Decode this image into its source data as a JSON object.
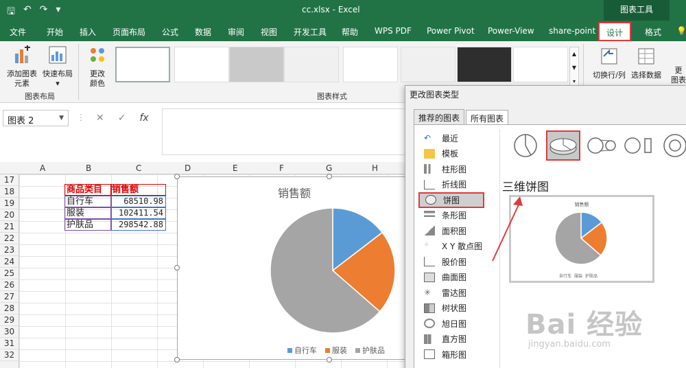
{
  "window": {
    "filename": "cc.xlsx",
    "app": "Excel",
    "separator": "-",
    "context_tools": "图表工具"
  },
  "qat": [
    "save-icon",
    "undo-icon",
    "redo-icon",
    "customize-icon"
  ],
  "tabs": [
    "文件",
    "开始",
    "插入",
    "页面布局",
    "公式",
    "数据",
    "审阅",
    "视图",
    "开发工具",
    "帮助",
    "WPS PDF",
    "Power Pivot",
    "Power-View",
    "share-point",
    "设计",
    "格式"
  ],
  "ribbon": {
    "add_element_1": "添加图表",
    "add_element_2": "元素",
    "quick_layout": "快速布局",
    "change_color_1": "更改",
    "change_color_2": "颜色",
    "group_layout": "图表布局",
    "group_styles": "图表样式",
    "switch_rowcol": "切换行/列",
    "select_data": "选择数据",
    "more_1": "更",
    "more_2": "图表"
  },
  "formula_bar": {
    "name_box": "图表 2",
    "fx": "fx"
  },
  "columns": [
    "A",
    "B",
    "C",
    "D",
    "E",
    "F",
    "G",
    "H"
  ],
  "rows": [
    "17",
    "18",
    "19",
    "20",
    "21",
    "22",
    "23",
    "24",
    "25",
    "26",
    "27",
    "28",
    "29",
    "30",
    "31",
    "32"
  ],
  "table": {
    "header": [
      "商品类目",
      "销售额"
    ],
    "rows": [
      [
        "自行车",
        "68510.98"
      ],
      [
        "服装",
        "102411.54"
      ],
      [
        "护肤品",
        "298542.88"
      ]
    ]
  },
  "colors": {
    "excel_green": "#217346",
    "series1": "#5b9bd5",
    "series2": "#ed7d31",
    "series3": "#a5a5a5",
    "highlight": "#e03a3a"
  },
  "chart_data": {
    "type": "pie",
    "title": "销售额",
    "categories": [
      "自行车",
      "服装",
      "护肤品"
    ],
    "values": [
      68510.98,
      102411.54,
      298542.88
    ],
    "legend": "bottom"
  },
  "dialog": {
    "title": "更改图表类型",
    "tabs": [
      "推荐的图表",
      "所有图表"
    ],
    "types": [
      "最近",
      "模板",
      "柱形图",
      "折线图",
      "饼图",
      "条形图",
      "面积图",
      "X Y 散点图",
      "股价图",
      "曲面图",
      "雷达图",
      "树状图",
      "旭日图",
      "直方图",
      "箱形图"
    ],
    "selected_type": "饼图",
    "subtype_label": "三维饼图",
    "preview_title": "销售额"
  },
  "watermark": {
    "brand": "Bai 经验",
    "url": "jingyan.baidu.com"
  }
}
